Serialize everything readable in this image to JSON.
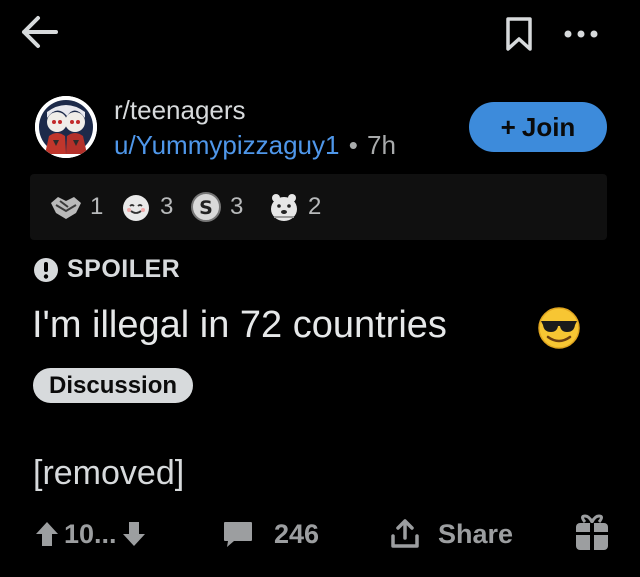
{
  "header": {
    "subreddit": "r/teenagers",
    "username": "u/Yummypizzaguy1",
    "dot": "•",
    "age": "7h",
    "join_label": "Join",
    "join_plus": "+"
  },
  "awards": [
    {
      "icon": "handshake-award-icon",
      "count": "1"
    },
    {
      "icon": "wholesome-award-icon",
      "count": "3"
    },
    {
      "icon": "silver-award-icon",
      "count": "3"
    },
    {
      "icon": "bear-award-icon",
      "count": "2"
    }
  ],
  "post": {
    "spoiler_label": "SPOILER",
    "title": "I'm illegal in 72 countries",
    "title_emoji": "sunglasses-face-icon",
    "flair": "Discussion",
    "body": "[removed]"
  },
  "footer": {
    "score": "10...",
    "comments": "246",
    "share_label": "Share"
  },
  "colors": {
    "background": "#000000",
    "accent_blue": "#3d8bdb",
    "username_blue": "#4f97ea",
    "text": "#d7dadc",
    "muted": "#9c9ea0"
  }
}
